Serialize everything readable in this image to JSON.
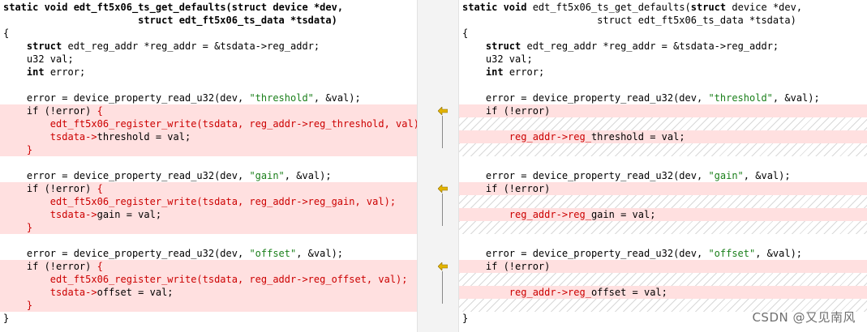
{
  "left": {
    "lines": [
      {
        "kind": "normal",
        "parts": [
          {
            "t": "static void",
            "c": "kw"
          },
          {
            "t": " edt_ft5x06_ts_get_defaults(",
            "c": "kw"
          },
          {
            "t": "struct",
            "c": "kw"
          },
          {
            "t": " device *dev,",
            "c": "kw"
          }
        ]
      },
      {
        "kind": "normal",
        "parts": [
          {
            "t": "                       struct edt_ft5x06_ts_data *tsdata)",
            "c": "kw"
          }
        ]
      },
      {
        "kind": "normal",
        "parts": [
          {
            "t": "{",
            "c": ""
          }
        ]
      },
      {
        "kind": "normal",
        "parts": [
          {
            "t": "    ",
            "c": ""
          },
          {
            "t": "struct",
            "c": "kw"
          },
          {
            "t": " edt_reg_addr *reg_addr = &tsdata->reg_addr;",
            "c": ""
          }
        ]
      },
      {
        "kind": "normal",
        "parts": [
          {
            "t": "    u32 val;",
            "c": ""
          }
        ]
      },
      {
        "kind": "normal",
        "parts": [
          {
            "t": "    ",
            "c": ""
          },
          {
            "t": "int",
            "c": "kw"
          },
          {
            "t": " error;",
            "c": ""
          }
        ]
      },
      {
        "kind": "normal",
        "parts": [
          {
            "t": "",
            "c": ""
          }
        ]
      },
      {
        "kind": "normal",
        "parts": [
          {
            "t": "    error = device_property_read_u32(dev, ",
            "c": ""
          },
          {
            "t": "\"threshold\"",
            "c": "str"
          },
          {
            "t": ", &val);",
            "c": ""
          }
        ]
      },
      {
        "kind": "changed",
        "parts": [
          {
            "t": "    if (!error) ",
            "c": ""
          },
          {
            "t": "{",
            "c": "red"
          }
        ]
      },
      {
        "kind": "changed",
        "parts": [
          {
            "t": "        edt_ft5x06_register_write(tsdata, reg_addr->reg_threshold, val);",
            "c": "red"
          }
        ]
      },
      {
        "kind": "changed",
        "parts": [
          {
            "t": "        ",
            "c": ""
          },
          {
            "t": "tsdata->",
            "c": "red"
          },
          {
            "t": "threshold = val;",
            "c": ""
          }
        ]
      },
      {
        "kind": "changed",
        "parts": [
          {
            "t": "    ",
            "c": ""
          },
          {
            "t": "}",
            "c": "red"
          }
        ]
      },
      {
        "kind": "normal",
        "parts": [
          {
            "t": "",
            "c": ""
          }
        ]
      },
      {
        "kind": "normal",
        "parts": [
          {
            "t": "    error = device_property_read_u32(dev, ",
            "c": ""
          },
          {
            "t": "\"gain\"",
            "c": "str"
          },
          {
            "t": ", &val);",
            "c": ""
          }
        ]
      },
      {
        "kind": "changed",
        "parts": [
          {
            "t": "    if (!error) ",
            "c": ""
          },
          {
            "t": "{",
            "c": "red"
          }
        ]
      },
      {
        "kind": "changed",
        "parts": [
          {
            "t": "        edt_ft5x06_register_write(tsdata, reg_addr->reg_gain, val);",
            "c": "red"
          }
        ]
      },
      {
        "kind": "changed",
        "parts": [
          {
            "t": "        ",
            "c": ""
          },
          {
            "t": "tsdata->",
            "c": "red"
          },
          {
            "t": "gain = val;",
            "c": ""
          }
        ]
      },
      {
        "kind": "changed",
        "parts": [
          {
            "t": "    ",
            "c": ""
          },
          {
            "t": "}",
            "c": "red"
          }
        ]
      },
      {
        "kind": "normal",
        "parts": [
          {
            "t": "",
            "c": ""
          }
        ]
      },
      {
        "kind": "normal",
        "parts": [
          {
            "t": "    error = device_property_read_u32(dev, ",
            "c": ""
          },
          {
            "t": "\"offset\"",
            "c": "str"
          },
          {
            "t": ", &val);",
            "c": ""
          }
        ]
      },
      {
        "kind": "changed",
        "parts": [
          {
            "t": "    if (!error) ",
            "c": ""
          },
          {
            "t": "{",
            "c": "red"
          }
        ]
      },
      {
        "kind": "changed",
        "parts": [
          {
            "t": "        edt_ft5x06_register_write(tsdata, reg_addr->reg_offset, val);",
            "c": "red"
          }
        ]
      },
      {
        "kind": "changed",
        "parts": [
          {
            "t": "        ",
            "c": ""
          },
          {
            "t": "tsdata->",
            "c": "red"
          },
          {
            "t": "offset = val;",
            "c": ""
          }
        ]
      },
      {
        "kind": "changed",
        "parts": [
          {
            "t": "    ",
            "c": ""
          },
          {
            "t": "}",
            "c": "red"
          }
        ]
      },
      {
        "kind": "normal",
        "parts": [
          {
            "t": "}",
            "c": ""
          }
        ]
      }
    ]
  },
  "right": {
    "lines": [
      {
        "kind": "normal",
        "parts": [
          {
            "t": "static void",
            "c": "kw"
          },
          {
            "t": " edt_ft5x06_ts_get_defaults(",
            "c": ""
          },
          {
            "t": "struct",
            "c": "kw"
          },
          {
            "t": " device *dev,",
            "c": ""
          }
        ]
      },
      {
        "kind": "normal",
        "parts": [
          {
            "t": "                       struct edt_ft5x06_ts_data *tsdata)",
            "c": ""
          }
        ]
      },
      {
        "kind": "normal",
        "parts": [
          {
            "t": "{",
            "c": ""
          }
        ]
      },
      {
        "kind": "normal",
        "parts": [
          {
            "t": "    ",
            "c": ""
          },
          {
            "t": "struct",
            "c": "kw"
          },
          {
            "t": " edt_reg_addr *reg_addr = &tsdata->reg_addr;",
            "c": ""
          }
        ]
      },
      {
        "kind": "normal",
        "parts": [
          {
            "t": "    u32 val;",
            "c": ""
          }
        ]
      },
      {
        "kind": "normal",
        "parts": [
          {
            "t": "    ",
            "c": ""
          },
          {
            "t": "int",
            "c": "kw"
          },
          {
            "t": " error;",
            "c": ""
          }
        ]
      },
      {
        "kind": "normal",
        "parts": [
          {
            "t": "",
            "c": ""
          }
        ]
      },
      {
        "kind": "normal",
        "parts": [
          {
            "t": "    error = device_property_read_u32(dev, ",
            "c": ""
          },
          {
            "t": "\"threshold\"",
            "c": "str"
          },
          {
            "t": ", &val);",
            "c": ""
          }
        ]
      },
      {
        "kind": "changed",
        "parts": [
          {
            "t": "    if (!error)",
            "c": ""
          }
        ]
      },
      {
        "kind": "hatch",
        "parts": [
          {
            "t": "",
            "c": ""
          }
        ]
      },
      {
        "kind": "changed",
        "parts": [
          {
            "t": "        ",
            "c": ""
          },
          {
            "t": "reg_addr->reg_",
            "c": "red"
          },
          {
            "t": "threshold = val;",
            "c": ""
          }
        ]
      },
      {
        "kind": "hatch",
        "parts": [
          {
            "t": "",
            "c": ""
          }
        ]
      },
      {
        "kind": "normal",
        "parts": [
          {
            "t": "",
            "c": ""
          }
        ]
      },
      {
        "kind": "normal",
        "parts": [
          {
            "t": "    error = device_property_read_u32(dev, ",
            "c": ""
          },
          {
            "t": "\"gain\"",
            "c": "str"
          },
          {
            "t": ", &val);",
            "c": ""
          }
        ]
      },
      {
        "kind": "changed",
        "parts": [
          {
            "t": "    if (!error)",
            "c": ""
          }
        ]
      },
      {
        "kind": "hatch",
        "parts": [
          {
            "t": "",
            "c": ""
          }
        ]
      },
      {
        "kind": "changed",
        "parts": [
          {
            "t": "        ",
            "c": ""
          },
          {
            "t": "reg_addr->reg_",
            "c": "red"
          },
          {
            "t": "gain = val;",
            "c": ""
          }
        ]
      },
      {
        "kind": "hatch",
        "parts": [
          {
            "t": "",
            "c": ""
          }
        ]
      },
      {
        "kind": "normal",
        "parts": [
          {
            "t": "",
            "c": ""
          }
        ]
      },
      {
        "kind": "normal",
        "parts": [
          {
            "t": "    error = device_property_read_u32(dev, ",
            "c": ""
          },
          {
            "t": "\"offset\"",
            "c": "str"
          },
          {
            "t": ", &val);",
            "c": ""
          }
        ]
      },
      {
        "kind": "changed",
        "parts": [
          {
            "t": "    if (!error)",
            "c": ""
          }
        ]
      },
      {
        "kind": "hatch",
        "parts": [
          {
            "t": "",
            "c": ""
          }
        ]
      },
      {
        "kind": "changed",
        "parts": [
          {
            "t": "        ",
            "c": ""
          },
          {
            "t": "reg_addr->reg_",
            "c": "red"
          },
          {
            "t": "offset = val;",
            "c": ""
          }
        ]
      },
      {
        "kind": "hatch",
        "parts": [
          {
            "t": "",
            "c": ""
          }
        ]
      },
      {
        "kind": "normal",
        "parts": [
          {
            "t": "}",
            "c": ""
          }
        ]
      }
    ]
  },
  "gutter": {
    "markers": [
      "arrow-left-icon",
      "arrow-left-icon",
      "arrow-left-icon"
    ],
    "marker_color": "#e3b400"
  },
  "colors": {
    "changed_bg": "#ffe0e0",
    "removed_text": "#cc0000",
    "string_text": "#1a7f1a"
  },
  "watermark": "CSDN @又见南风"
}
